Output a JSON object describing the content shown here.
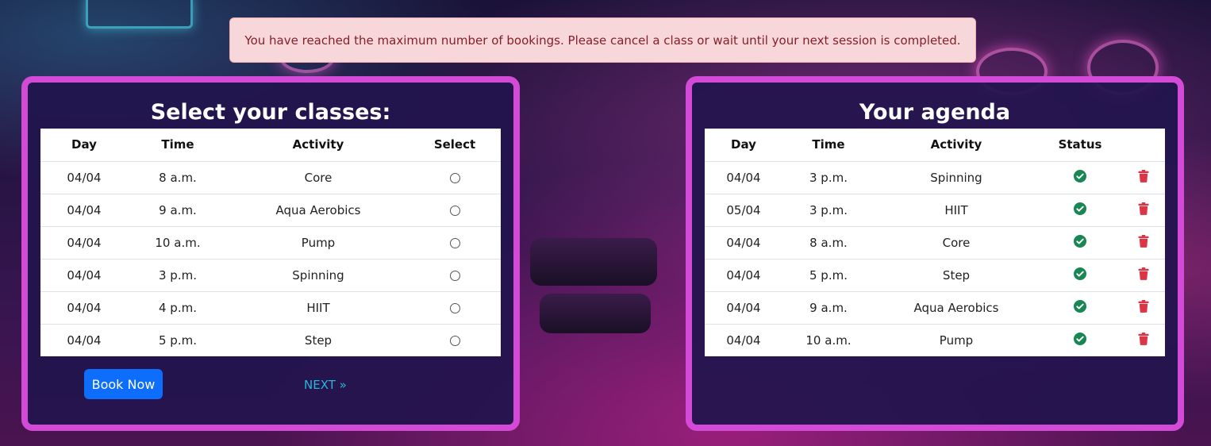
{
  "alert": {
    "message": "You have reached the maximum number of bookings. Please cancel a class or wait until your next session is completed."
  },
  "classes": {
    "title": "Select your classes:",
    "headers": [
      "Day",
      "Time",
      "Activity",
      "Select"
    ],
    "rows": [
      {
        "day": "04/04",
        "time": "8 a.m.",
        "activity": "Core"
      },
      {
        "day": "04/04",
        "time": "9 a.m.",
        "activity": "Aqua Aerobics"
      },
      {
        "day": "04/04",
        "time": "10 a.m.",
        "activity": "Pump"
      },
      {
        "day": "04/04",
        "time": "3 p.m.",
        "activity": "Spinning"
      },
      {
        "day": "04/04",
        "time": "4 p.m.",
        "activity": "HIIT"
      },
      {
        "day": "04/04",
        "time": "5 p.m.",
        "activity": "Step"
      }
    ],
    "book_label": "Book Now",
    "next_label": "NEXT »"
  },
  "agenda": {
    "title": "Your agenda",
    "headers": [
      "Day",
      "Time",
      "Activity",
      "Status",
      ""
    ],
    "rows": [
      {
        "day": "04/04",
        "time": "3 p.m.",
        "activity": "Spinning"
      },
      {
        "day": "05/04",
        "time": "3 p.m.",
        "activity": "HIIT"
      },
      {
        "day": "04/04",
        "time": "8 a.m.",
        "activity": "Core"
      },
      {
        "day": "04/04",
        "time": "5 p.m.",
        "activity": "Step"
      },
      {
        "day": "04/04",
        "time": "9 a.m.",
        "activity": "Aqua Aerobics"
      },
      {
        "day": "04/04",
        "time": "10 a.m.",
        "activity": "Pump"
      }
    ],
    "status_icon": "check-circle-icon",
    "delete_icon": "trash-icon"
  },
  "colors": {
    "panel_border": "#d24ad6",
    "book_button": "#0d6efd",
    "status_ok": "#198754",
    "delete": "#dc3545",
    "alert_bg": "#f8d7da",
    "alert_text": "#842029"
  }
}
